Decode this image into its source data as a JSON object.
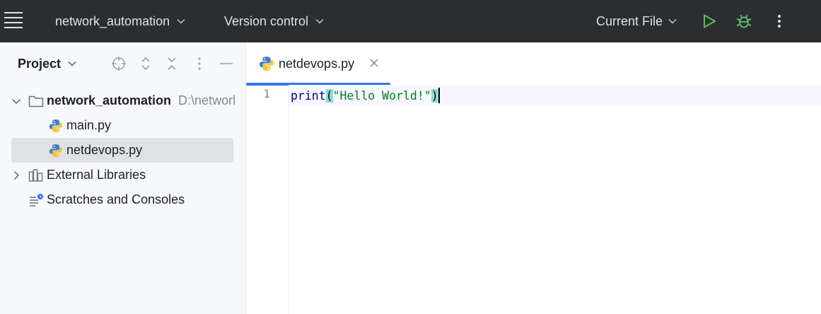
{
  "titlebar": {
    "project_name": "network_automation",
    "vcs_label": "Version control",
    "run_config": "Current File",
    "colors": {
      "background": "#2b2d30",
      "run": "#5fb865",
      "debug": "#5fb865"
    }
  },
  "project_panel": {
    "title": "Project",
    "tree": {
      "root": {
        "name": "network_automation",
        "path": "D:\\networl"
      },
      "files": [
        "main.py",
        "netdevops.py"
      ],
      "external_libraries": "External Libraries",
      "scratches": "Scratches and Consoles"
    },
    "selected_file": "netdevops.py"
  },
  "editor": {
    "tab": {
      "label": "netdevops.py"
    },
    "line_number": "1",
    "code": {
      "fn": "print",
      "open_paren": "(",
      "string": "\"Hello World!\"",
      "close_paren": ")"
    },
    "colors": {
      "accent": "#3574f0",
      "string": "#067d17",
      "function": "#000080",
      "brace_match": "#93d9d9"
    }
  }
}
